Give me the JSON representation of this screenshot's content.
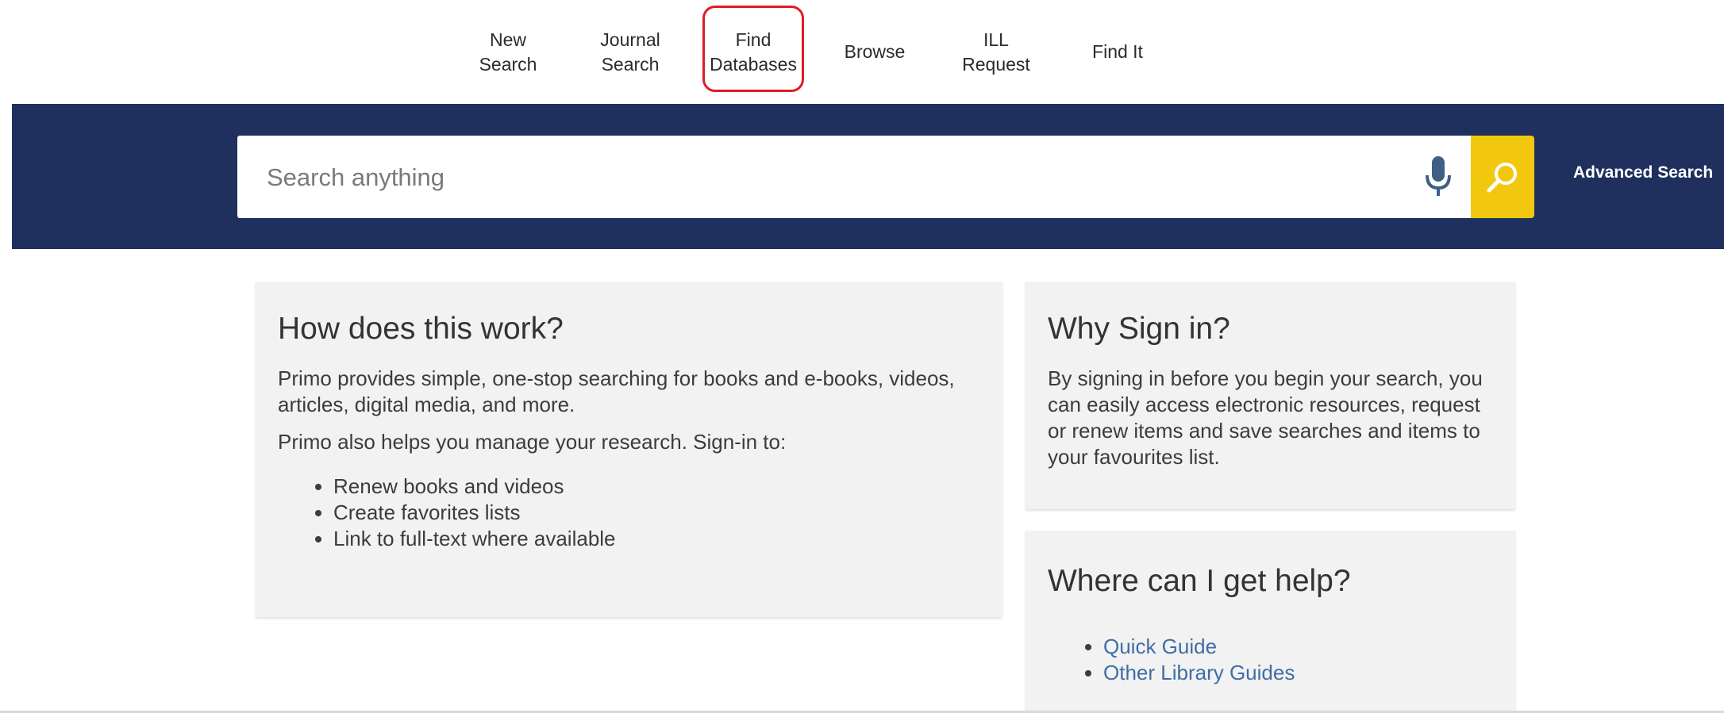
{
  "topnav": {
    "items": [
      {
        "label": "New\nSearch"
      },
      {
        "label": "Journal\nSearch"
      },
      {
        "label": "Find\nDatabases"
      },
      {
        "label": "Browse"
      },
      {
        "label": "ILL\nRequest"
      },
      {
        "label": "Find It"
      }
    ],
    "highlighted_item": "Find Databases",
    "highlight_color": "#e01b24"
  },
  "search": {
    "placeholder": "Search anything",
    "value": "",
    "mic_icon": "microphone-icon",
    "search_icon": "magnifier-icon",
    "advanced_label": "Advanced Search",
    "band_color": "#1f305e",
    "button_color": "#f2c80f"
  },
  "cards": {
    "how": {
      "title": "How does this work?",
      "para1": "Primo provides simple, one-stop searching for books and e-books, videos, articles, digital media, and more.",
      "para2": "Primo also helps you manage your research. Sign-in to:",
      "items": [
        "Renew books and videos",
        "Create favorites lists",
        "Link to full-text where available"
      ]
    },
    "why": {
      "title": "Why Sign in?",
      "para": "By signing in before you begin your search, you can easily access electronic resources, request or renew items and save searches and items to your favourites list."
    },
    "help": {
      "title": "Where can I get help?",
      "links": [
        "Quick Guide",
        "Other Library Guides"
      ],
      "link_color": "#3f6ea6"
    }
  }
}
